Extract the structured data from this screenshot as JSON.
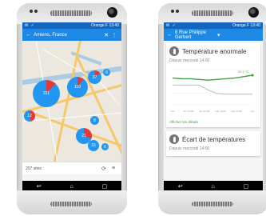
{
  "left_phone": {
    "status": {
      "left_icons": "✉ ✓",
      "right_text": "Orange F 13:40"
    },
    "appbar": {
      "title": "Amiens, France",
      "back_icon": "arrow-left-icon",
      "close_icon": "close-icon",
      "more_icon": "more-vert-icon"
    },
    "clusters": [
      {
        "label": "221",
        "color": "#2196f3",
        "cut": "#e53935"
      },
      {
        "label": "110",
        "color": "#2196f3",
        "cut": "#e53935"
      },
      {
        "label": "37",
        "color": "#2196f3",
        "cut": "#e53935"
      },
      {
        "label": "8",
        "color": "#2196f3",
        "cut": "#e53935"
      },
      {
        "label": "12",
        "color": "#2196f3",
        "cut": "#e53935"
      },
      {
        "label": "21",
        "color": "#2196f3",
        "cut": "#e53935"
      },
      {
        "label": "15",
        "color": "#2196f3",
        "cut": "#e53935"
      },
      {
        "label": "8",
        "color": "#2196f3",
        "cut": "#e53935"
      },
      {
        "label": "6",
        "color": "#2196f3",
        "cut": "#e53935"
      }
    ],
    "footer": {
      "count": "207 sites"
    }
  },
  "right_phone": {
    "status": {
      "left_icons": "✉ ✓",
      "right_text": "Orange F 13:40"
    },
    "appbar": {
      "title": "8 Rue Philippe Gerbert",
      "back_icon": "arrow-left-icon",
      "dropdown_icon": "chevron-down-icon"
    },
    "card1": {
      "title": "Température anormale",
      "since": "Depuis mercredi 14:00",
      "link": "Afficher les détails"
    },
    "card2": {
      "title": "Écart de températures",
      "since": "Depuis mercredi 14:00"
    },
    "chart_data": {
      "type": "line",
      "series": [
        {
          "color": "#43a047",
          "values": [
            21.8,
            21.7,
            21.7,
            21.6,
            21.5,
            21.6,
            21.7,
            21.8,
            22.0,
            22.2
          ]
        },
        {
          "color": "#bdbdbd",
          "values": [
            20.8,
            20.8,
            20.8,
            20.8,
            20.1,
            19.6,
            19.5,
            19.5,
            19.5,
            19.5
          ]
        }
      ],
      "ylim": [
        18,
        23
      ],
      "current_value": "22.2 °C",
      "ticks": [
        "mer",
        "lun 14:00",
        "lun 14:00",
        "mar 14:00",
        "mar 14:00",
        "mer"
      ]
    },
    "colors": {
      "primary": "#1e88e5",
      "status": "#1565c0",
      "accent": "#43a047"
    }
  },
  "nav": {
    "back_icon": "back-icon",
    "home_icon": "home-icon",
    "recents_icon": "recents-icon"
  }
}
